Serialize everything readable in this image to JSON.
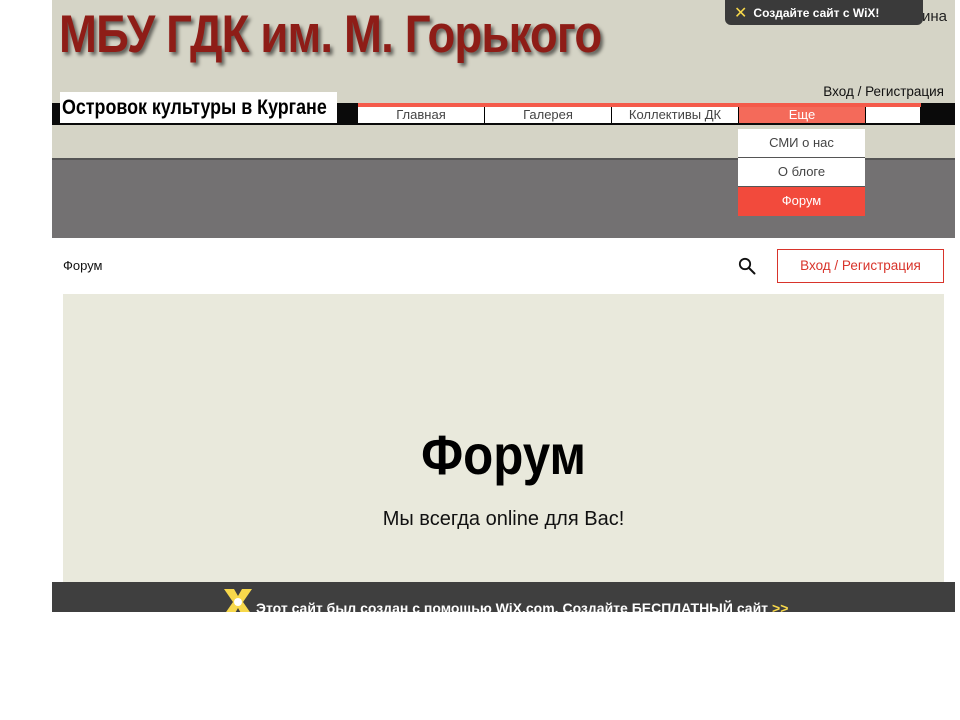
{
  "header": {
    "site_title": "МБУ ГДК им. М. Горького",
    "tail_text": "ина",
    "wix_pill": {
      "icon": "wix-x-icon",
      "glyph": "✕",
      "label": "Создайте сайт с WiX!"
    },
    "login_link": "Вход / Регистрация",
    "tagline": "Островок культуры в Кургане"
  },
  "nav": {
    "items": [
      {
        "label": "Главная"
      },
      {
        "label": "Галерея"
      },
      {
        "label": "Коллективы ДК"
      },
      {
        "label": "Еще"
      }
    ],
    "active_index": 3
  },
  "dropdown": {
    "items": [
      {
        "label": "СМИ о нас"
      },
      {
        "label": "О блоге"
      },
      {
        "label": "Форум"
      }
    ],
    "active_index": 2
  },
  "forum_bar": {
    "breadcrumb": "Форум",
    "search_icon": "search-icon",
    "login_button": "Вход / Регистрация"
  },
  "hero": {
    "title": "Форум",
    "subtitle": "Мы всегда online для Вас!"
  },
  "wix_footer": {
    "text": "Этот сайт был создан с помощью WiX.com. Создайте БЕСПЛАТНЫЙ сайт",
    "arrows": ">>"
  },
  "colors": {
    "title_red": "#8e1d17",
    "accent_red": "#f24a3c",
    "header_bg": "#d5d4c6",
    "hero_bg": "#e9e9dc",
    "band_gray": "#737172",
    "wix_yellow": "#f7d84b"
  }
}
